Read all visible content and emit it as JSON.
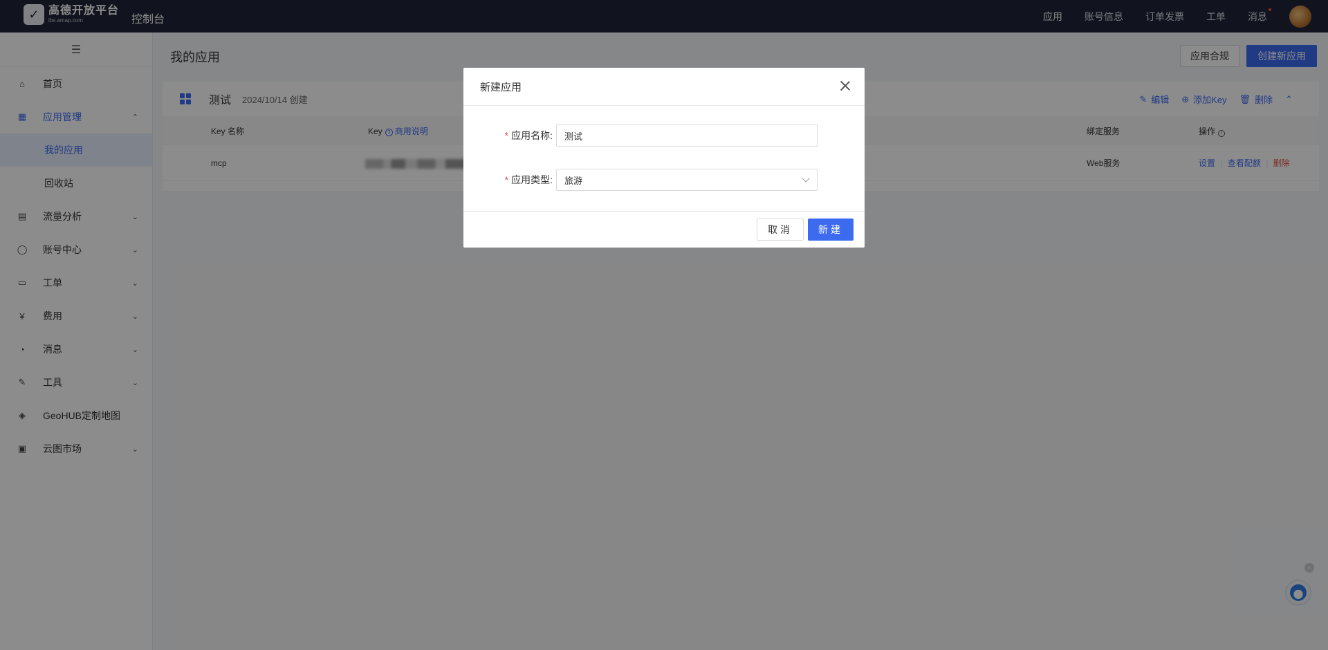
{
  "topbar": {
    "logo_text": "高德开放平台",
    "logo_sub": "lbs.amap.com",
    "console_title": "控制台",
    "nav": [
      {
        "label": "应用",
        "active": true
      },
      {
        "label": "账号信息"
      },
      {
        "label": "订单发票"
      },
      {
        "label": "工单"
      },
      {
        "label": "消息",
        "dot": true
      }
    ]
  },
  "sidebar": {
    "toggle_icon": "menu-icon",
    "items": [
      {
        "label": "首页",
        "icon": "home-icon"
      },
      {
        "label": "应用管理",
        "icon": "apps-icon",
        "open": true
      },
      {
        "label": "我的应用",
        "sub": true,
        "active": true
      },
      {
        "label": "回收站",
        "sub": true
      },
      {
        "label": "流量分析",
        "icon": "chart-icon"
      },
      {
        "label": "账号中心",
        "icon": "user-icon"
      },
      {
        "label": "工单",
        "icon": "ticket-icon"
      },
      {
        "label": "费用",
        "icon": "billing-icon"
      },
      {
        "label": "消息",
        "icon": "message-icon"
      },
      {
        "label": "工具",
        "icon": "tool-icon"
      },
      {
        "label": "GeoHUB定制地图",
        "icon": "layers-icon"
      },
      {
        "label": "云图市场",
        "icon": "store-icon"
      }
    ]
  },
  "main": {
    "page_title": "我的应用",
    "compliance_button": "应用合规",
    "create_button": "创建新应用",
    "app": {
      "name": "测试",
      "created": "2024/10/14 创建",
      "actions": {
        "edit": "编辑",
        "add_key": "添加Key",
        "delete": "删除"
      },
      "table": {
        "headers": {
          "key_name": "Key 名称",
          "key": "Key",
          "key_help": "商用说明",
          "service": "绑定服务",
          "ops": "操作"
        },
        "rows": [
          {
            "key_name": "mcp",
            "service": "Web服务",
            "ops": [
              "设置",
              "查看配额",
              "删除"
            ]
          }
        ]
      }
    }
  },
  "dialog": {
    "title": "新建应用",
    "fields": {
      "name_label": "应用名称:",
      "name_value": "测试",
      "type_label": "应用类型:",
      "type_value": "旅游"
    },
    "cancel": "取消",
    "ok": "新建"
  }
}
